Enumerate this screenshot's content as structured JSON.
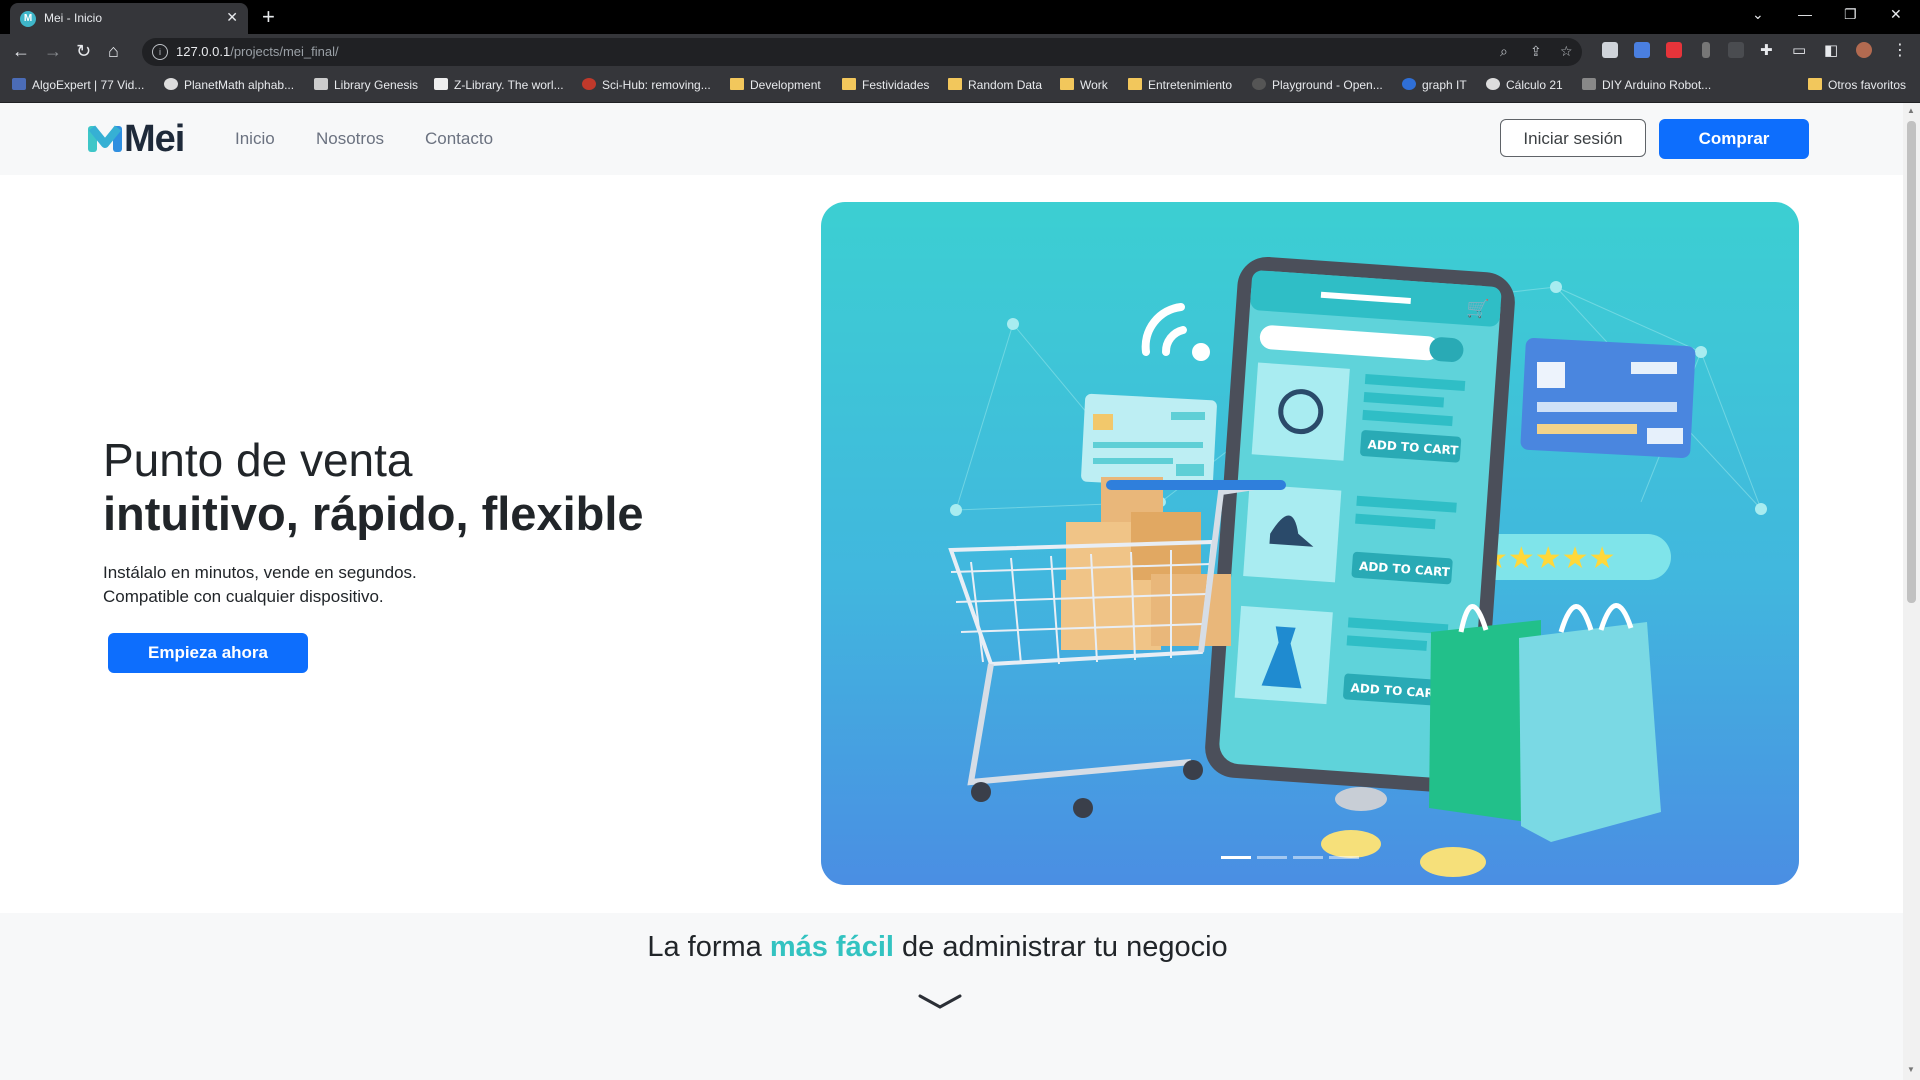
{
  "browser": {
    "tab_title": "Mei - Inicio",
    "tab_favicon_letter": "M",
    "url_host": "127.0.0.1",
    "url_path": "/projects/mei_final/",
    "bookmarks": [
      {
        "label": "AlgoExpert | 77 Vid...",
        "icon": "algoexpert-icon"
      },
      {
        "label": "PlanetMath alphab...",
        "icon": "planetmath-icon"
      },
      {
        "label": "Library Genesis",
        "icon": "libgen-icon"
      },
      {
        "label": "Z-Library. The worl...",
        "icon": "zlibrary-icon"
      },
      {
        "label": "Sci-Hub: removing...",
        "icon": "scihub-icon"
      },
      {
        "label": "Development",
        "icon": "folder-icon"
      },
      {
        "label": "Festividades",
        "icon": "folder-icon"
      },
      {
        "label": "Random Data",
        "icon": "folder-icon"
      },
      {
        "label": "Work",
        "icon": "folder-icon"
      },
      {
        "label": "Entretenimiento",
        "icon": "folder-icon"
      },
      {
        "label": "Playground - Open...",
        "icon": "openai-icon"
      },
      {
        "label": "graph IT",
        "icon": "graphit-icon"
      },
      {
        "label": "Cálculo 21",
        "icon": "calculo-icon"
      },
      {
        "label": "DIY Arduino Robot...",
        "icon": "arduino-icon"
      }
    ],
    "other_bookmarks": "Otros favoritos"
  },
  "site": {
    "brand": "Mei",
    "nav": [
      {
        "label": "Inicio"
      },
      {
        "label": "Nosotros"
      },
      {
        "label": "Contacto"
      }
    ],
    "login_button": "Iniciar sesión",
    "buy_button": "Comprar"
  },
  "hero": {
    "title_line1": "Punto de venta",
    "title_line2": "intuitivo, rápido, flexible",
    "subtitle_line1": "Instálalo en minutos, vende en segundos.",
    "subtitle_line2": "Compatible con cualquier dispositivo.",
    "cta": "Empieza ahora",
    "illustration": {
      "add_to_cart": "ADD TO CART",
      "add_to_cart_cut": "ADD TO CAR",
      "carousel_active_index": 0,
      "carousel_count": 4
    }
  },
  "tagline": {
    "before": "La forma ",
    "highlight": "más fácil",
    "after": " de administrar tu negocio"
  },
  "colors": {
    "primary": "#0d6efd",
    "accent": "#33c3c1",
    "hero_gradient_top": "#3ccfd2",
    "hero_gradient_bottom": "#4a8ee3"
  }
}
